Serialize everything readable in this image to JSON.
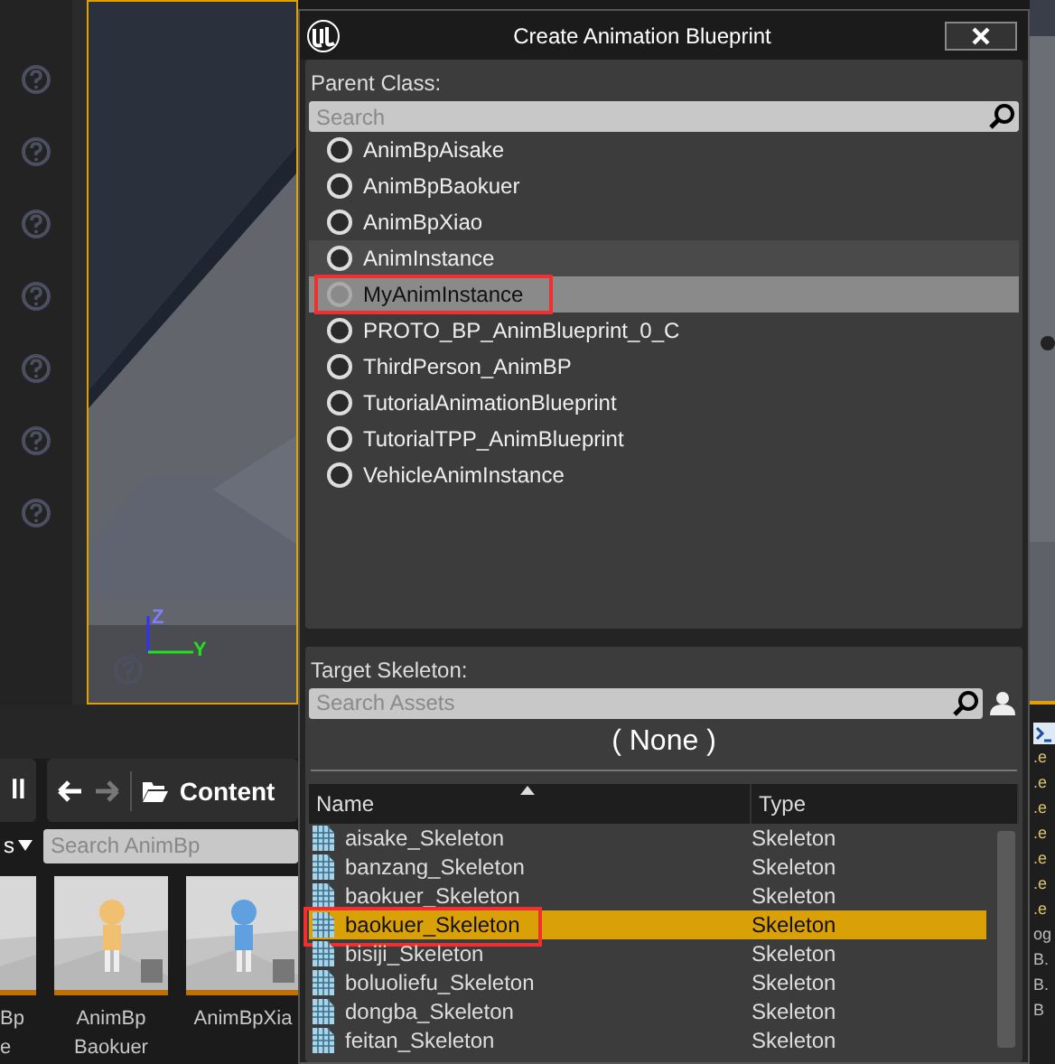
{
  "viewport": {
    "kind": "picture",
    "axes": [
      "Z",
      "Y"
    ]
  },
  "content_browser": {
    "toolbar_button": "ll",
    "path": "Content",
    "filter": "s",
    "search": {
      "placeholder": "Search AnimBp"
    },
    "assets": [
      {
        "lines": [
          "Bp",
          "e"
        ]
      },
      {
        "lines": [
          "AnimBp",
          "Baokuer"
        ]
      },
      {
        "lines": [
          "AnimBpXia"
        ]
      }
    ]
  },
  "console": {
    "lines": [
      ".e",
      ".e",
      ".e",
      ".e",
      ".e",
      ".e",
      ".e",
      "og",
      "B.",
      "B.",
      "B"
    ]
  },
  "dialog": {
    "title": "Create Animation Blueprint",
    "parent_class": {
      "label": "Parent Class:",
      "search": {
        "placeholder": "Search"
      },
      "items": [
        {
          "label": "AnimBpAisake",
          "selected": false,
          "hovered": false,
          "annotated": false
        },
        {
          "label": "AnimBpBaokuer",
          "selected": false,
          "hovered": false,
          "annotated": false
        },
        {
          "label": "AnimBpXiao",
          "selected": false,
          "hovered": false,
          "annotated": false
        },
        {
          "label": "AnimInstance",
          "selected": false,
          "hovered": true,
          "annotated": false
        },
        {
          "label": "MyAnimInstance",
          "selected": true,
          "hovered": false,
          "annotated": true
        },
        {
          "label": "PROTO_BP_AnimBlueprint_0_C",
          "selected": false,
          "hovered": false,
          "annotated": false
        },
        {
          "label": "ThirdPerson_AnimBP",
          "selected": false,
          "hovered": false,
          "annotated": false
        },
        {
          "label": "TutorialAnimationBlueprint",
          "selected": false,
          "hovered": false,
          "annotated": false
        },
        {
          "label": "TutorialTPP_AnimBlueprint",
          "selected": false,
          "hovered": false,
          "annotated": false
        },
        {
          "label": "VehicleAnimInstance",
          "selected": false,
          "hovered": false,
          "annotated": false
        }
      ]
    },
    "target_skeleton": {
      "label": "Target Skeleton:",
      "search": {
        "placeholder": "Search Assets"
      },
      "current": "( None )",
      "columns": [
        "Name",
        "Type"
      ],
      "rows": [
        {
          "name": "aisake_Skeleton",
          "type": "Skeleton",
          "selected": false,
          "annotated": false
        },
        {
          "name": "banzang_Skeleton",
          "type": "Skeleton",
          "selected": false,
          "annotated": false
        },
        {
          "name": "baokuer_Skeleton",
          "type": "Skeleton",
          "selected": false,
          "annotated": false
        },
        {
          "name": "baokuer_Skeleton",
          "type": "Skeleton",
          "selected": true,
          "annotated": true
        },
        {
          "name": "bisiji_Skeleton",
          "type": "Skeleton",
          "selected": false,
          "annotated": false
        },
        {
          "name": "boluoliefu_Skeleton",
          "type": "Skeleton",
          "selected": false,
          "annotated": false
        },
        {
          "name": "dongba_Skeleton",
          "type": "Skeleton",
          "selected": false,
          "annotated": false
        },
        {
          "name": "feitan_Skeleton",
          "type": "Skeleton",
          "selected": false,
          "annotated": false
        }
      ]
    }
  }
}
